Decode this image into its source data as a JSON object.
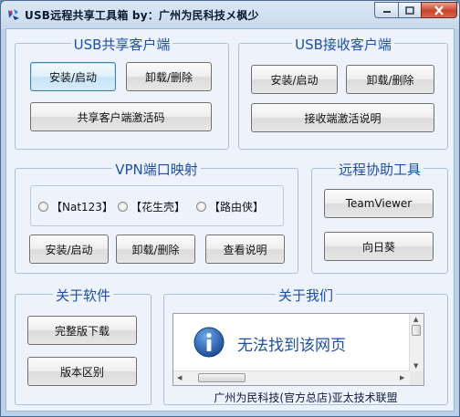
{
  "window": {
    "title": "USB远程共享工具箱 by：广州为民科技メ枫少",
    "controls": {
      "minimize": "minimize",
      "maximize": "maximize",
      "close": "close"
    }
  },
  "share_client": {
    "title": "USB共享客户端",
    "install_label": "安装/启动",
    "uninstall_label": "卸载/删除",
    "activation_label": "共享客户端激活码"
  },
  "receive_client": {
    "title": "USB接收客户端",
    "install_label": "安装/启动",
    "uninstall_label": "卸载/删除",
    "activation_label": "接收端激活说明"
  },
  "vpn": {
    "title": "VPN端口映射",
    "options": [
      "【Nat123】",
      "【花生壳】",
      "【路由侠】"
    ],
    "selected": null,
    "install_label": "安装/启动",
    "uninstall_label": "卸载/删除",
    "help_label": "查看说明"
  },
  "remote_tools": {
    "title": "远程协助工具",
    "teamviewer_label": "TeamViewer",
    "sunflower_label": "向日葵"
  },
  "about_software": {
    "title": "关于软件",
    "download_label": "完整版下载",
    "versions_label": "版本区别"
  },
  "about_us": {
    "title": "关于我们",
    "browser_message": "无法找到该网页",
    "footer": "广州为民科技(官方总店)亚太技术联盟"
  },
  "colors": {
    "group_title": "#1c4fa8",
    "client_bg": "#eef3fb",
    "close_button": "#c9442c"
  },
  "icons": [
    "app-icon",
    "info-icon"
  ]
}
